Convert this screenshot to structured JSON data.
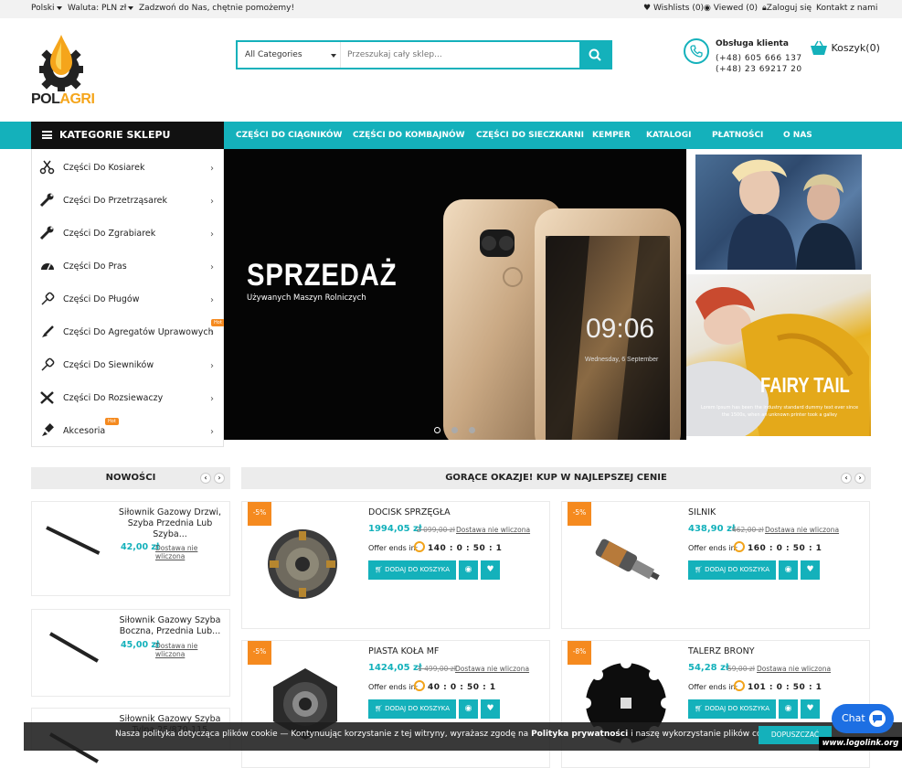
{
  "topbar": {
    "language": "Polski",
    "currency": "Waluta: PLN zł",
    "tagline": "Zadzwoń do Nas, chętnie pomożemy!",
    "wishlists": "Wishlists (0)",
    "viewed": "Viewed (0)",
    "login": "Zaloguj się",
    "contact": "Kontakt z nami"
  },
  "brand": {
    "logo_text_a": "POL",
    "logo_text_b": "AGRI"
  },
  "search": {
    "category": "All Categories",
    "placeholder": "Przeszukaj cały sklep..."
  },
  "support": {
    "title": "Obsługa klienta",
    "phone1": "(+48) 605 666 137",
    "phone2": "(+48) 23 69217 20"
  },
  "cart": {
    "label": "Koszyk(0)"
  },
  "nav": {
    "categories_button": "KATEGORIE SKLEPU",
    "items": [
      "CZĘŚCI DO CIĄGNIKÓW",
      "CZĘŚCI DO KOMBAJNÓW",
      "CZĘŚCI DO SIECZKARNI",
      "KEMPER",
      "KATALOGI",
      "PŁATNOŚCI",
      "O NAS"
    ]
  },
  "categories": [
    {
      "label": "Części Do Kosiarek",
      "icon": "scissors-icon"
    },
    {
      "label": "Części Do Przetrząsarek",
      "icon": "wrench-icon"
    },
    {
      "label": "Części Do Zgrabiarek",
      "icon": "wrench-icon"
    },
    {
      "label": "Części Do Pras",
      "icon": "gauge-icon"
    },
    {
      "label": "Części Do Pługów",
      "icon": "plug-icon"
    },
    {
      "label": "Części Do Agregatów Uprawowych",
      "icon": "paint-brush-icon",
      "badge": "Hot"
    },
    {
      "label": "Części Do Siewników",
      "icon": "plug-icon"
    },
    {
      "label": "Części Do Rozsiewaczy",
      "icon": "tools-icon"
    },
    {
      "label": "Akcesoria",
      "icon": "brush-icon",
      "badge": "Hot"
    }
  ],
  "slider": {
    "title": "SPRZEDAŻ",
    "subtitle": "Używanych Maszyn Rolniczych",
    "phone_time": "09:06",
    "phone_date": "Wednesday, 6 September"
  },
  "banner2": {
    "title": "FAIRY TAIL",
    "text": "Lorem Ipsum has been the industry standard dummy text ever since the 1500s, when an unknown printer took a galley"
  },
  "nowosci": {
    "title": "NOWOŚCI",
    "items": [
      {
        "title": "Siłownik Gazowy Drzwi, Szyba Przednia Lub Szyba...",
        "price": "42,00 zł",
        "shipping": "Dostawa nie wliczona"
      },
      {
        "title": "Siłownik Gazowy Szyba Boczna, Przednia Lub...",
        "price": "45,00 zł",
        "shipping": "Dostawa nie wliczona"
      },
      {
        "title": "Siłownik Gazowy Szyba Tylna 25/870-115",
        "price": "",
        "shipping": ""
      }
    ]
  },
  "deals": {
    "title": "GORĄCE OKAZJE! KUP W NAJLEPSZEJ CENIE",
    "offer_label": "Offer ends in:",
    "add_label": "DODAJ DO KOSZYKA",
    "items": [
      {
        "badge": "-5%",
        "title": "DOCISK SPRZĘGŁA",
        "price": "1994,05 zł",
        "old_price": "2 099,00 zł",
        "shipping": "Dostawa nie wliczona",
        "timer": "140 : 0 : 50 : 1"
      },
      {
        "badge": "-5%",
        "title": "SILNIK",
        "price": "438,90 zł",
        "old_price": "462,00 zł",
        "shipping": "Dostawa nie wliczona",
        "timer": "160 : 0 : 50 : 1"
      },
      {
        "badge": "-5%",
        "title": "PIASTA KOŁA MF",
        "price": "1424,05 zł",
        "old_price": "1 499,00 zł",
        "shipping": "Dostawa nie wliczona",
        "timer": "40 : 0 : 50 : 1"
      },
      {
        "badge": "-8%",
        "title": "TALERZ BRONY",
        "price": "54,28 zł",
        "old_price": "59,00 zł",
        "shipping": "Dostawa nie wliczona",
        "timer": "101 : 0 : 50 : 1"
      }
    ]
  },
  "cookie": {
    "text_a": "Nasza polityka dotycząca plików cookie — Kontynuując korzystanie z tej witryny, wyrażasz zgodę na",
    "link": "Polityka prywatności",
    "text_b": "i naszę wykorzystanie plików cookie.",
    "button": "DOPUSZCZAĆ"
  },
  "chat": {
    "label": "Chat"
  },
  "watermark": "www.logolink.org",
  "colors": {
    "accent": "#14b1bb",
    "dark": "#111111",
    "hot": "#f58a1f"
  }
}
